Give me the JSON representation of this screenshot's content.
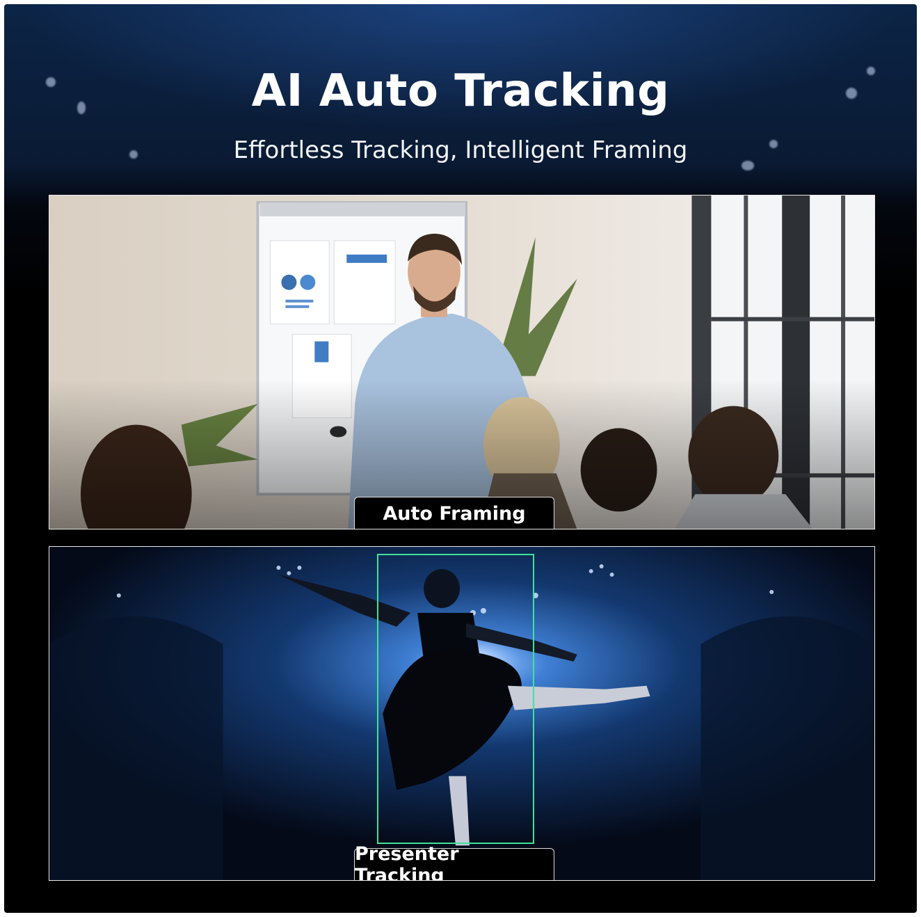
{
  "header": {
    "title": "AI Auto Tracking",
    "subtitle": "Effortless Tracking, Intelligent Framing"
  },
  "panels": [
    {
      "label": "Auto Framing",
      "scene": "conference-room-presenter"
    },
    {
      "label": "Presenter Tracking",
      "scene": "ballet-dancer-on-stage"
    }
  ],
  "colors": {
    "background": "#000000",
    "header_glow": "#0c2446",
    "tracking_box": "#3fe29a",
    "caption_bg": "#000000",
    "text": "#ffffff"
  }
}
